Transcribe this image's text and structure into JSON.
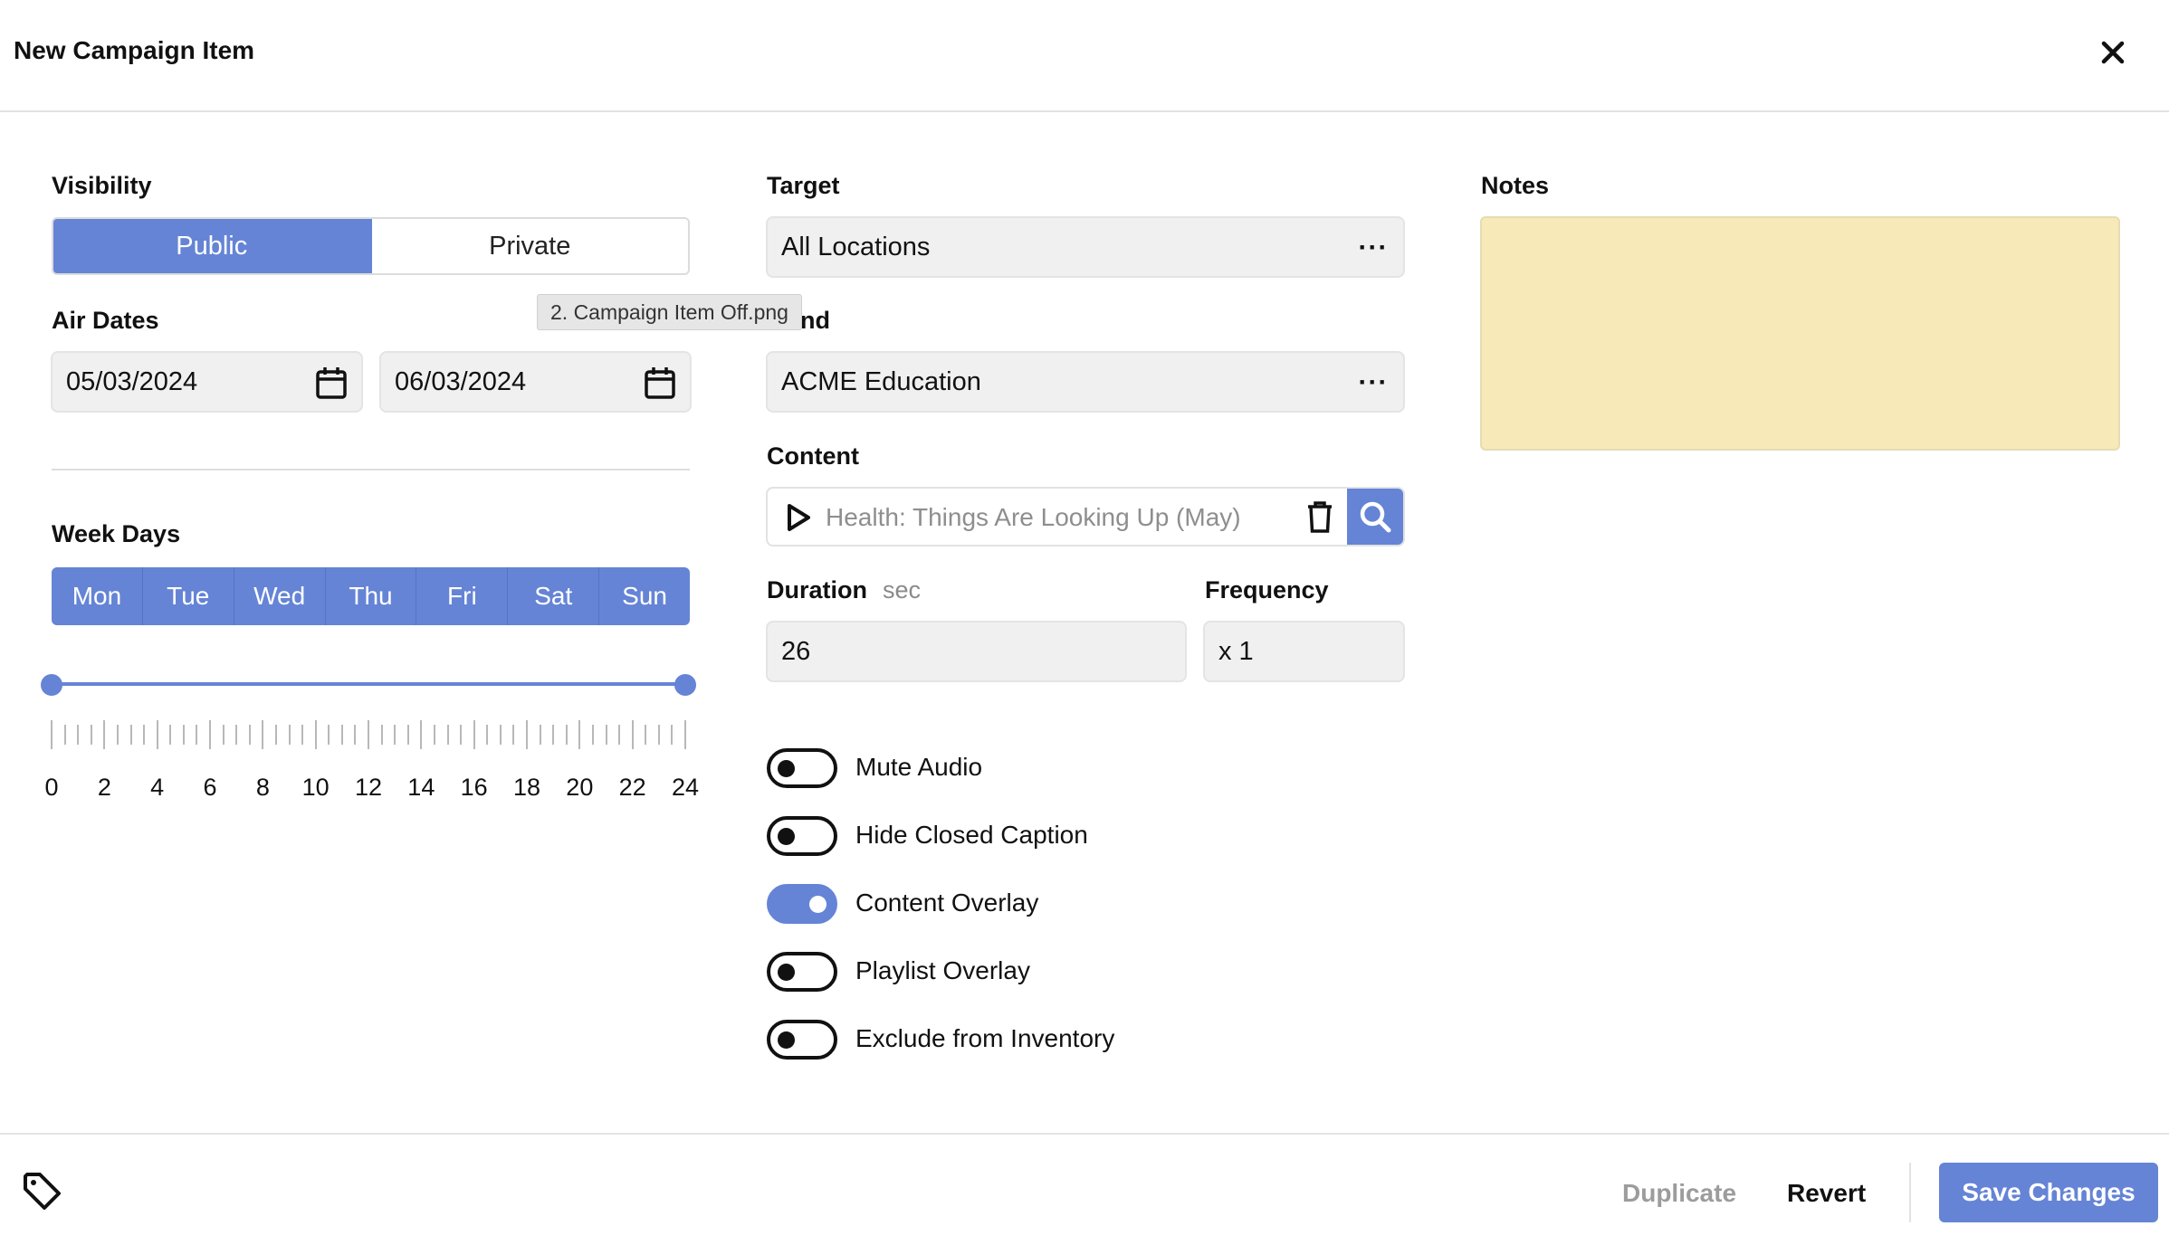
{
  "dialog": {
    "title": "New Campaign Item"
  },
  "visibility": {
    "label": "Visibility",
    "options": [
      "Public",
      "Private"
    ],
    "selected": "Public"
  },
  "air_dates": {
    "label": "Air Dates",
    "start": "05/03/2024",
    "end": "06/03/2024"
  },
  "week_days": {
    "label": "Week Days",
    "days": [
      "Mon",
      "Tue",
      "Wed",
      "Thu",
      "Fri",
      "Sat",
      "Sun"
    ]
  },
  "hours": {
    "tick_labels": [
      "0",
      "2",
      "4",
      "6",
      "8",
      "10",
      "12",
      "14",
      "16",
      "18",
      "20",
      "22",
      "24"
    ],
    "range_start": 0,
    "range_end": 24
  },
  "target": {
    "label": "Target",
    "value": "All Locations"
  },
  "brand": {
    "label_visible": "nd",
    "value": "ACME Education"
  },
  "tooltip": {
    "text": "2. Campaign Item Off.png"
  },
  "content": {
    "label": "Content",
    "placeholder": "Health: Things Are Looking Up (May)"
  },
  "duration": {
    "label": "Duration",
    "unit": "sec",
    "value": "26"
  },
  "frequency": {
    "label": "Frequency",
    "value": "x 1"
  },
  "toggles": [
    {
      "label": "Mute Audio",
      "on": false
    },
    {
      "label": "Hide Closed Caption",
      "on": false
    },
    {
      "label": "Content Overlay",
      "on": true
    },
    {
      "label": "Playlist Overlay",
      "on": false
    },
    {
      "label": "Exclude from Inventory",
      "on": false
    }
  ],
  "notes": {
    "label": "Notes",
    "value": ""
  },
  "footer": {
    "duplicate_label": "Duplicate",
    "revert_label": "Revert",
    "save_label": "Save Changes"
  },
  "colors": {
    "accent": "#6584d6",
    "notes_bg": "#f7eab8"
  }
}
